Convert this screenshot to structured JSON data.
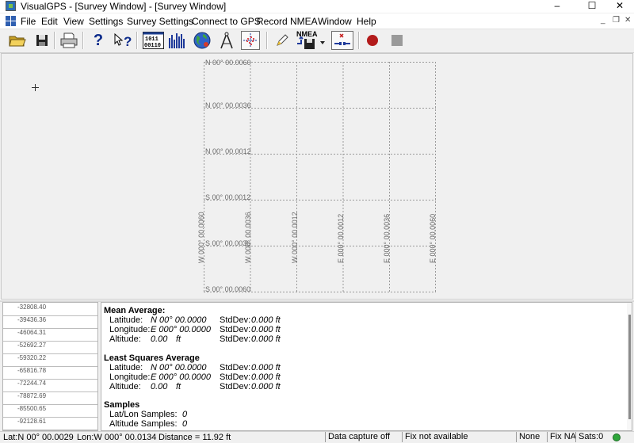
{
  "window": {
    "title": "VisualGPS - [Survey Window] - [Survey Window]",
    "minimize": "–",
    "maximize": "☐",
    "close": "✕"
  },
  "menu": {
    "items": [
      "File",
      "Edit",
      "View",
      "Settings",
      "Survey Settings",
      "Connect to GPS",
      "Record NMEA",
      "Window",
      "Help"
    ],
    "mdi_minimize": "_",
    "mdi_restore": "❐",
    "mdi_close": "✕"
  },
  "toolbar": {
    "nmea_label": "NMEA",
    "icons": [
      "open-folder-icon",
      "save-disk-icon",
      "print-icon",
      "help-icon",
      "context-help-icon",
      "nmea-monitor-icon",
      "signal-bars-icon",
      "globe-icon",
      "compass-icon",
      "survey-plot-icon",
      "edit-icon",
      "record-nmea-icon",
      "connection-icon",
      "record-icon",
      "stop-icon"
    ],
    "colors": {
      "record": "#b31b1b",
      "stop": "#9a9a9a"
    }
  },
  "survey": {
    "lat_labels": [
      "N 00° 00.0060",
      "N 00° 00.0036",
      "N 00° 00.0012",
      "S 00° 00.0012",
      "S 00° 00.0036",
      "S 00° 00.0060"
    ],
    "lon_labels": [
      "W 000° 00.0060",
      "W 000° 00.0036",
      "W 000° 00.0012",
      "E 000° 00.0012",
      "E 000° 00.0036",
      "E 000° 00.0060"
    ]
  },
  "altitude_scale": [
    "-32808.40",
    "-39436.36",
    "-46064.31",
    "-52692.27",
    "-59320.22",
    "-65816.78",
    "-72244.74",
    "-78872.69",
    "-85500.65",
    "-92128.61"
  ],
  "stats": {
    "mean": {
      "heading": "Mean Average:",
      "latitude_label": "Latitude:",
      "latitude": "N 00° 00.0000",
      "longitude_label": "Longitude:",
      "longitude": "E 000° 00.0000",
      "altitude_label": "Altitude:",
      "altitude": "0.00",
      "altitude_unit": "ft",
      "stddev_label": "StdDev:",
      "sd_lat": "0.000 ft",
      "sd_lon": "0.000 ft",
      "sd_alt": "0.000 ft"
    },
    "lsq": {
      "heading": "Least Squares Average",
      "latitude_label": "Latitude:",
      "latitude": "N 00° 00.0000",
      "longitude_label": "Longitude:",
      "longitude": "E 000° 00.0000",
      "altitude_label": "Altitude:",
      "altitude": "0.00",
      "altitude_unit": "ft",
      "stddev_label": "StdDev:",
      "sd_lat": "0.000 ft",
      "sd_lon": "0.000 ft",
      "sd_alt": "0.000 ft"
    },
    "samples": {
      "heading": "Samples",
      "latlon_label": "Lat/Lon Samples:",
      "latlon": "0",
      "altitude_label": "Altitude Samples:",
      "altitude": "0"
    }
  },
  "status": {
    "lat": "Lat:N 00° 00.0029",
    "lon": "Lon:W 000° 00.0134",
    "distance": "Distance = 11.92 ft",
    "capture": "Data capture off",
    "fix": "Fix not available",
    "dgps": "None",
    "fix_type": "Fix NA",
    "sats": "Sats:0",
    "led_color": "#2ea63a"
  }
}
